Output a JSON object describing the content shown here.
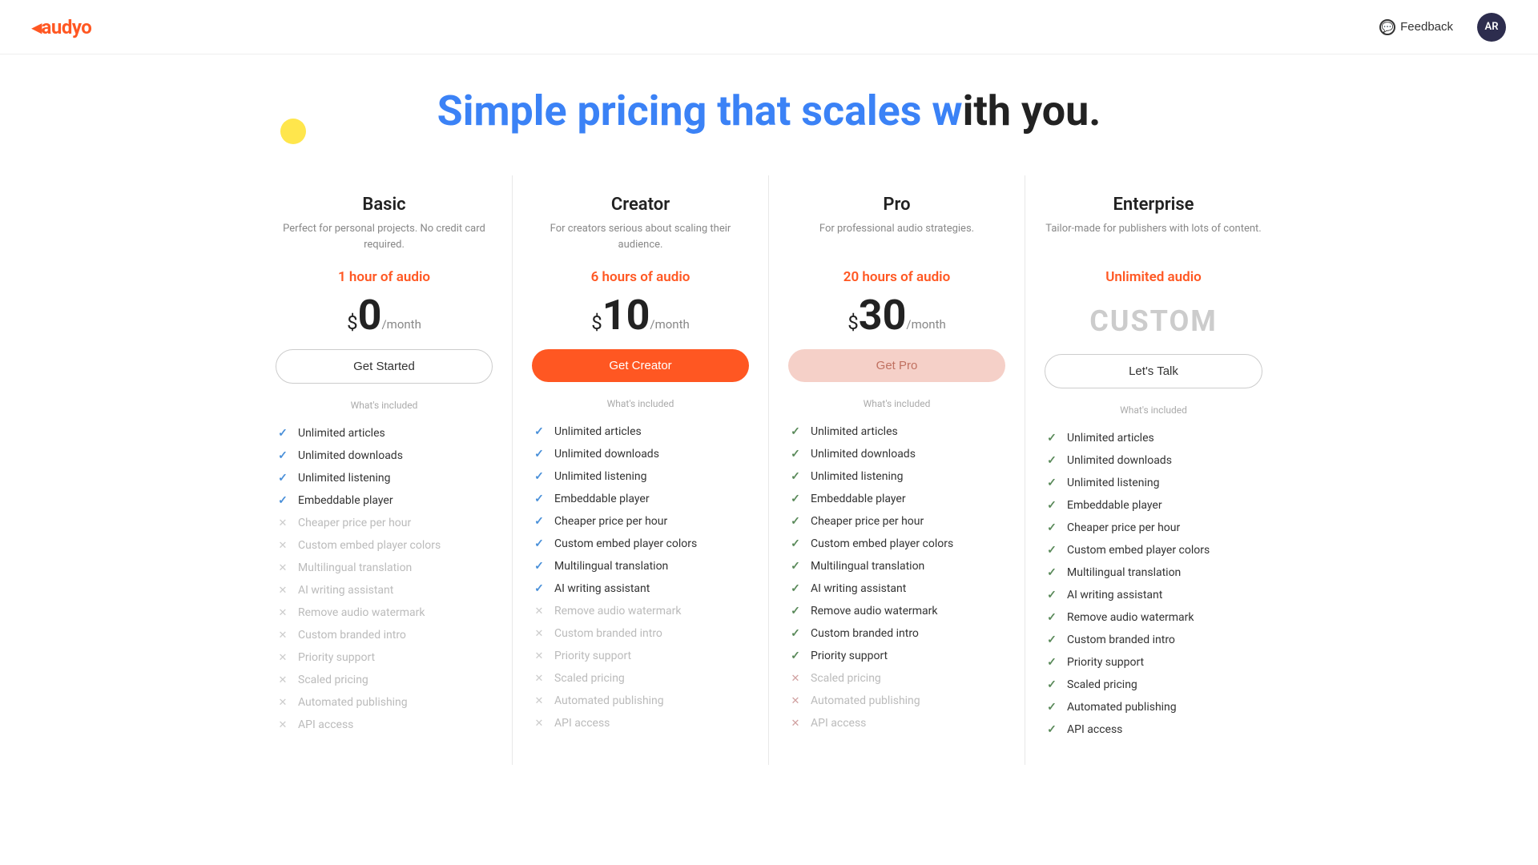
{
  "header": {
    "logo": "audyo",
    "feedback_label": "Feedback",
    "avatar_initials": "AR"
  },
  "hero": {
    "title_highlight": "Simple pricing that scales w",
    "title_normal": "ith you."
  },
  "plans": [
    {
      "id": "basic",
      "name": "Basic",
      "desc": "Perfect for personal projects. No credit card required.",
      "audio": "1 hour of audio",
      "price_symbol": "$",
      "price_amount": "0",
      "price_period": "/month",
      "button_label": "Get Started",
      "button_class": "btn-basic",
      "whats_included": "What's included",
      "features": [
        {
          "label": "Unlimited articles",
          "status": "included"
        },
        {
          "label": "Unlimited downloads",
          "status": "included"
        },
        {
          "label": "Unlimited listening",
          "status": "included"
        },
        {
          "label": "Embeddable player",
          "status": "included"
        },
        {
          "label": "Cheaper price per hour",
          "status": "excluded"
        },
        {
          "label": "Custom embed player colors",
          "status": "excluded"
        },
        {
          "label": "Multilingual translation",
          "status": "excluded"
        },
        {
          "label": "AI writing assistant",
          "status": "excluded"
        },
        {
          "label": "Remove audio watermark",
          "status": "excluded"
        },
        {
          "label": "Custom branded intro",
          "status": "excluded"
        },
        {
          "label": "Priority support",
          "status": "excluded"
        },
        {
          "label": "Scaled pricing",
          "status": "excluded"
        },
        {
          "label": "Automated publishing",
          "status": "excluded"
        },
        {
          "label": "API access",
          "status": "excluded"
        }
      ]
    },
    {
      "id": "creator",
      "name": "Creator",
      "desc": "For creators serious about scaling their audience.",
      "audio": "6 hours of audio",
      "price_symbol": "$",
      "price_amount": "10",
      "price_period": "/month",
      "button_label": "Get Creator",
      "button_class": "btn-creator",
      "whats_included": "What's included",
      "features": [
        {
          "label": "Unlimited articles",
          "status": "included"
        },
        {
          "label": "Unlimited downloads",
          "status": "included"
        },
        {
          "label": "Unlimited listening",
          "status": "included"
        },
        {
          "label": "Embeddable player",
          "status": "included"
        },
        {
          "label": "Cheaper price per hour",
          "status": "included"
        },
        {
          "label": "Custom embed player colors",
          "status": "included"
        },
        {
          "label": "Multilingual translation",
          "status": "included"
        },
        {
          "label": "AI writing assistant",
          "status": "included"
        },
        {
          "label": "Remove audio watermark",
          "status": "excluded"
        },
        {
          "label": "Custom branded intro",
          "status": "excluded"
        },
        {
          "label": "Priority support",
          "status": "excluded"
        },
        {
          "label": "Scaled pricing",
          "status": "excluded"
        },
        {
          "label": "Automated publishing",
          "status": "excluded"
        },
        {
          "label": "API access",
          "status": "excluded"
        }
      ]
    },
    {
      "id": "pro",
      "name": "Pro",
      "desc": "For professional audio strategies.",
      "audio": "20 hours of audio",
      "price_symbol": "$",
      "price_amount": "30",
      "price_period": "/month",
      "button_label": "Get Pro",
      "button_class": "btn-pro",
      "whats_included": "What's included",
      "features": [
        {
          "label": "Unlimited articles",
          "status": "included"
        },
        {
          "label": "Unlimited downloads",
          "status": "included"
        },
        {
          "label": "Unlimited listening",
          "status": "included"
        },
        {
          "label": "Embeddable player",
          "status": "included"
        },
        {
          "label": "Cheaper price per hour",
          "status": "included"
        },
        {
          "label": "Custom embed player colors",
          "status": "included"
        },
        {
          "label": "Multilingual translation",
          "status": "included"
        },
        {
          "label": "AI writing assistant",
          "status": "included"
        },
        {
          "label": "Remove audio watermark",
          "status": "included"
        },
        {
          "label": "Custom branded intro",
          "status": "included"
        },
        {
          "label": "Priority support",
          "status": "included"
        },
        {
          "label": "Scaled pricing",
          "status": "excluded-x"
        },
        {
          "label": "Automated publishing",
          "status": "excluded-x"
        },
        {
          "label": "API access",
          "status": "excluded-x"
        }
      ]
    },
    {
      "id": "enterprise",
      "name": "Enterprise",
      "desc": "Tailor-made for publishers with lots of content.",
      "audio": "Unlimited audio",
      "price_custom": "CUSTOM",
      "button_label": "Let's Talk",
      "button_class": "btn-enterprise",
      "whats_included": "What's included",
      "features": [
        {
          "label": "Unlimited articles",
          "status": "included"
        },
        {
          "label": "Unlimited downloads",
          "status": "included"
        },
        {
          "label": "Unlimited listening",
          "status": "included"
        },
        {
          "label": "Embeddable player",
          "status": "included"
        },
        {
          "label": "Cheaper price per hour",
          "status": "included"
        },
        {
          "label": "Custom embed player colors",
          "status": "included"
        },
        {
          "label": "Multilingual translation",
          "status": "included"
        },
        {
          "label": "AI writing assistant",
          "status": "included"
        },
        {
          "label": "Remove audio watermark",
          "status": "included"
        },
        {
          "label": "Custom branded intro",
          "status": "included"
        },
        {
          "label": "Priority support",
          "status": "included"
        },
        {
          "label": "Scaled pricing",
          "status": "included"
        },
        {
          "label": "Automated publishing",
          "status": "included"
        },
        {
          "label": "API access",
          "status": "included"
        }
      ]
    }
  ]
}
